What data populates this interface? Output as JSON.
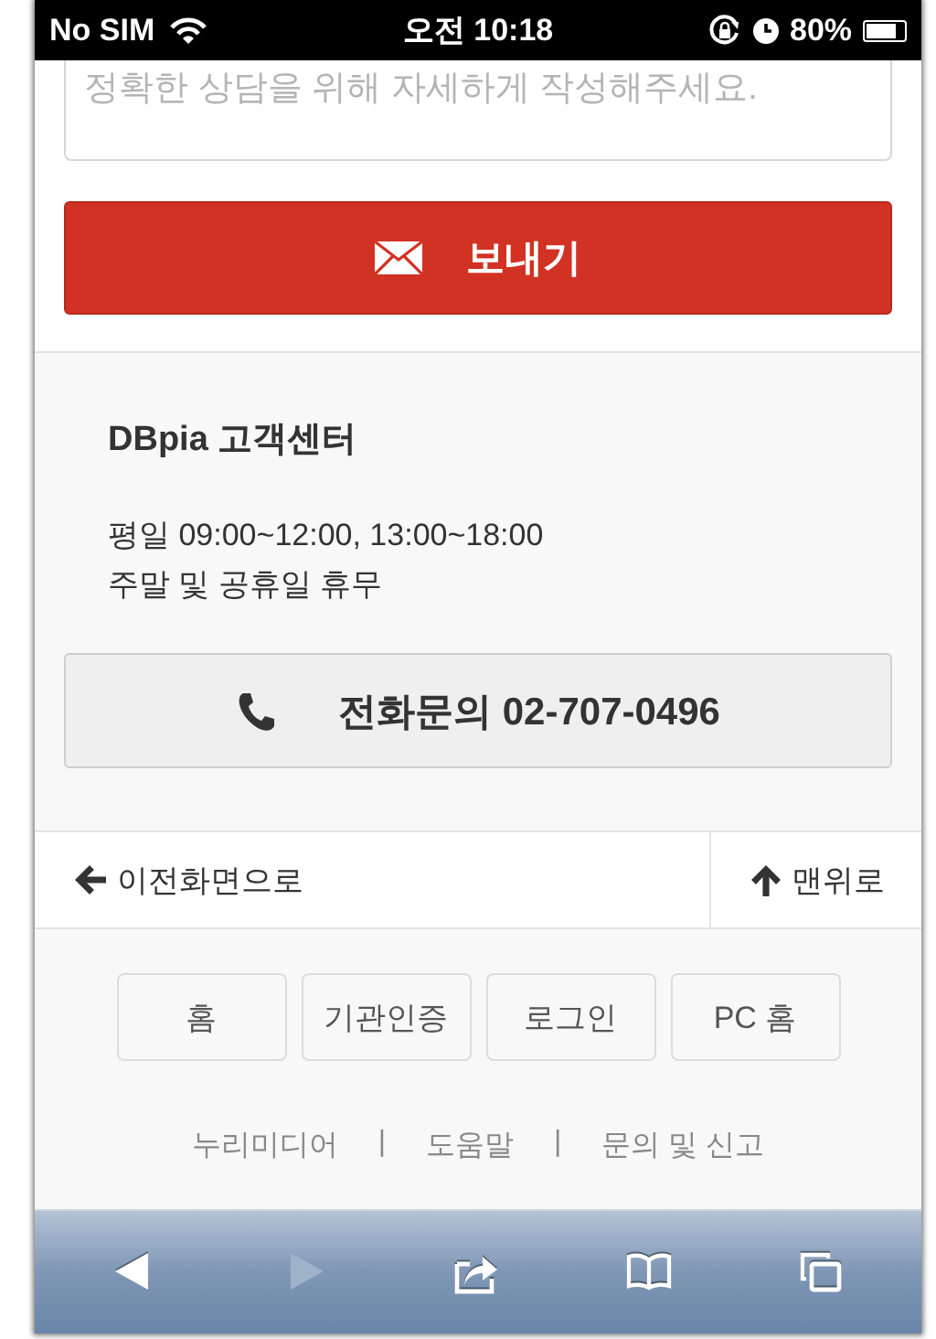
{
  "status_bar": {
    "carrier": "No SIM",
    "time": "오전 10:18",
    "battery": {
      "text": "80%",
      "level": 0.8
    }
  },
  "message_field": {
    "placeholder": "정확한 상담을 위해 자세하게 작성해주세요."
  },
  "send_button": {
    "label": "보내기"
  },
  "support": {
    "title": "DBpia 고객센터",
    "hours": [
      "평일 09:00~12:00, 13:00~18:00",
      "주말 및 공휴일 휴무"
    ],
    "phone_button": "전화문의 02-707-0496"
  },
  "nav": {
    "back": "이전화면으로",
    "top": "맨위로"
  },
  "footer_buttons": [
    "홈",
    "기관인증",
    "로그인",
    "PC 홈"
  ],
  "footer_links": [
    "누리미디어",
    "도움말",
    "문의 및 신고"
  ],
  "footer_separator": "|",
  "toolbar": [
    {
      "kind": "back",
      "disabled": false
    },
    {
      "kind": "forward",
      "disabled": true
    },
    {
      "kind": "share",
      "disabled": false
    },
    {
      "kind": "bookmarks",
      "disabled": false
    },
    {
      "kind": "tabs",
      "disabled": false
    }
  ]
}
